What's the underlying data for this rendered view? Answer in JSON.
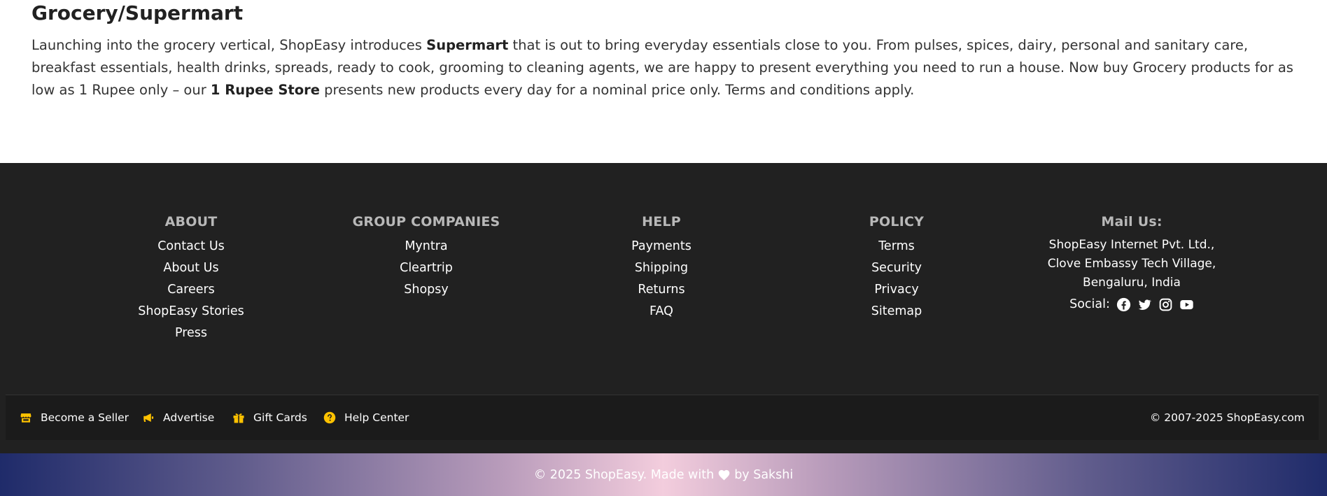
{
  "section": {
    "title": "Grocery/Supermart",
    "para_1": "Launching into the grocery vertical, ShopEasy introduces ",
    "bold_1": "Supermart",
    "para_2": " that is out to bring everyday essentials close to you. From pulses, spices, dairy, personal and sanitary care, breakfast essentials, health drinks, spreads, ready to cook, grooming to cleaning agents, we are happy to present everything you need to run a house. Now buy Grocery products for as low as 1 Rupee only – our ",
    "bold_2": "1 Rupee Store",
    "para_3": " presents new products every day for a nominal price only. Terms and conditions apply."
  },
  "footer": {
    "about": {
      "heading": "ABOUT",
      "links": [
        "Contact Us",
        "About Us",
        "Careers",
        "ShopEasy Stories",
        "Press"
      ]
    },
    "group": {
      "heading": "GROUP COMPANIES",
      "links": [
        "Myntra",
        "Cleartrip",
        "Shopsy"
      ]
    },
    "help": {
      "heading": "HELP",
      "links": [
        "Payments",
        "Shipping",
        "Returns",
        "FAQ"
      ]
    },
    "policy": {
      "heading": "POLICY",
      "links": [
        "Terms",
        "Security",
        "Privacy",
        "Sitemap"
      ]
    },
    "mail": {
      "heading": "Mail Us:",
      "address": [
        "ShopEasy Internet Pvt. Ltd.,",
        "Clove Embassy Tech Village,",
        "Bengaluru, India"
      ],
      "social_label": "Social:",
      "social_icons": [
        "facebook-icon",
        "twitter-icon",
        "instagram-icon",
        "youtube-icon"
      ]
    }
  },
  "bottom_bar": {
    "items": [
      {
        "label": "Become a Seller",
        "icon": "store-icon"
      },
      {
        "label": "Advertise",
        "icon": "megaphone-icon"
      },
      {
        "label": "Gift Cards",
        "icon": "gift-icon"
      },
      {
        "label": "Help Center",
        "icon": "question-icon"
      }
    ],
    "copyright": "© 2007-2025 ShopEasy.com",
    "icon_color": "#ffc200"
  },
  "credit": {
    "prefix": "© 2025 ShopEasy. Made with",
    "suffix": "by Sakshi"
  }
}
